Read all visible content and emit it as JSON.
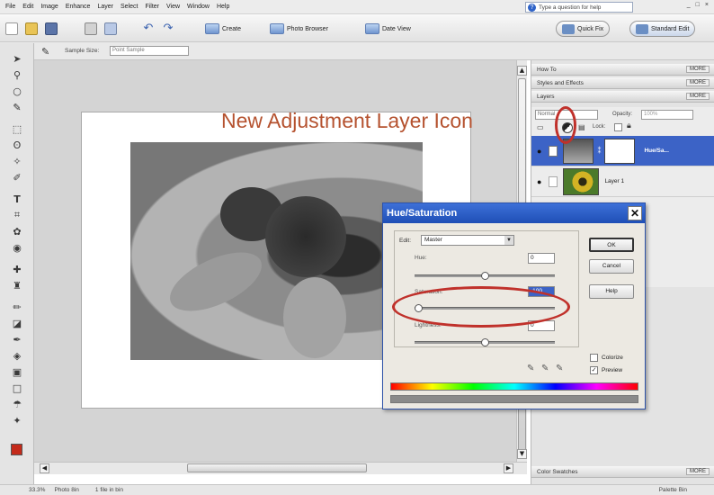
{
  "menu": [
    "File",
    "Edit",
    "Image",
    "Enhance",
    "Layer",
    "Select",
    "Filter",
    "View",
    "Window",
    "Help"
  ],
  "help_search": {
    "placeholder": "Type a question for help"
  },
  "window_controls": [
    "_",
    "□",
    "×"
  ],
  "toolbar": {
    "create_label": "Create",
    "photo_browser_label": "Photo Browser",
    "date_view_label": "Date View",
    "quick_fix_label": "Quick Fix",
    "standard_edit_label": "Standard Edit"
  },
  "options_bar": {
    "sample_size_label": "Sample Size:",
    "sample_size_value": "Point Sample"
  },
  "annotation": "New Adjustment Layer Icon",
  "palettes": {
    "how_to": "How To",
    "styles_effects": "Styles and Effects",
    "layers": "Layers",
    "color_swatches": "Color Swatches",
    "more_label": "MORE"
  },
  "layers": {
    "blend_mode": "Normal",
    "opacity_label": "Opacity:",
    "opacity_value": "100%",
    "lock_label": "Lock:",
    "items": [
      {
        "name": "Hue/Sa..."
      },
      {
        "name": "Layer 1"
      }
    ]
  },
  "dialog": {
    "title": "Hue/Saturation",
    "edit_label": "Edit:",
    "edit_value": "Master",
    "hue_label": "Hue:",
    "hue_value": "0",
    "saturation_label": "Saturation:",
    "saturation_value": "-100",
    "lightness_label": "Lightness:",
    "lightness_value": "0",
    "ok_label": "OK",
    "cancel_label": "Cancel",
    "help_label": "Help",
    "colorize_label": "Colorize",
    "preview_label": "Preview",
    "hue_level": 0.5,
    "saturation_level": 0.0,
    "lightness_level": 0.5
  },
  "status": {
    "zoom": "33.3%",
    "doc_info": "Photo 8in",
    "size_info": "1 file in bin",
    "bin_label": "Palette Bin"
  },
  "colors": {
    "accent": "#2f63c8",
    "annotation": "#b5522f",
    "highlight_ring": "#c0312b",
    "foreground_swatch": "#c42a1a"
  }
}
